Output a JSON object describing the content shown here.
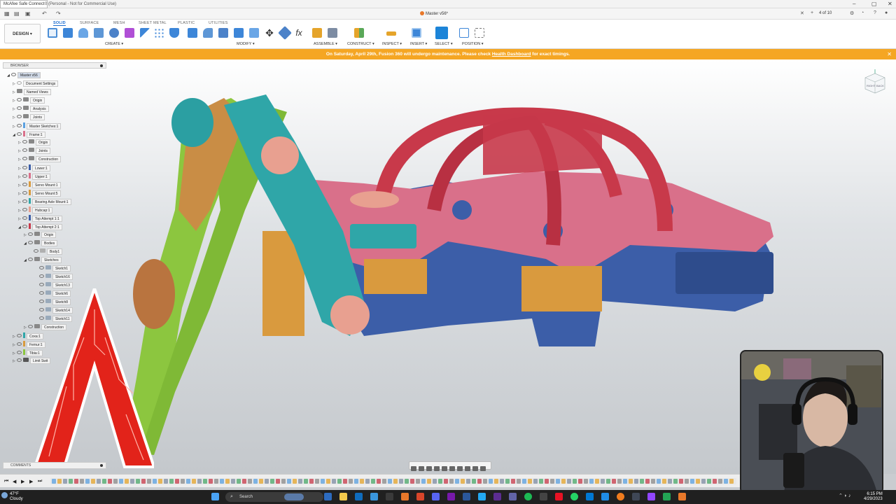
{
  "title_bar": {
    "notification": "McAfee Safe Connect",
    "subtitle": "0 (Personal - Not for Commercial Use)"
  },
  "document": {
    "title": "Master v56*",
    "page_indicator": "4 of 10"
  },
  "toolbar": {
    "workspace_button": "DESIGN ▾",
    "tabs": [
      "SOLID",
      "SURFACE",
      "MESH",
      "SHEET METAL",
      "PLASTIC",
      "UTILITIES"
    ],
    "active_tab": "SOLID",
    "groups": {
      "create": "CREATE ▾",
      "modify": "MODIFY ▾",
      "assemble": "ASSEMBLE ▾",
      "construct": "CONSTRUCT ▾",
      "inspect": "INSPECT ▾",
      "insert": "INSERT ▾",
      "select": "SELECT ▾",
      "position": "POSITION ▾"
    }
  },
  "banner": {
    "text_before": "On Saturday, April 29th, Fusion 360 will undergo maintenance. Please check ",
    "link": "Health Dashboard",
    "text_after": " for exact timings.",
    "close": "✕"
  },
  "browser": {
    "header": "BROWSER",
    "items": {
      "root": "Master v56",
      "document_settings": "Document Settings",
      "named_views": "Named Views",
      "origin": "Origin",
      "analysis": "Analysis",
      "joints": "Joints",
      "master_sketches": "Master Sketches:1",
      "frame": "Frame:1",
      "frame_origin": "Origin",
      "frame_joints": "Joints",
      "frame_construction": "Construction",
      "lower": "Lower:1",
      "upper": "Upper:1",
      "servo_mount_1": "Servo Mount:1",
      "servo_mount_5": "Servo Mount:5",
      "bearing_axle_mount": "Bearing Axle Mount:1",
      "hubcap": "Hubcap:1",
      "top_attempt_1": "Top Attempt 1:1",
      "top_attempt_2": "Top Attempt 2:1",
      "ta2_origin": "Origin",
      "ta2_bodies": "Bodies",
      "body1": "Body1",
      "ta2_sketches": "Sketches",
      "sketch1": "Sketch1",
      "sketch16": "Sketch16",
      "sketch13": "Sketch13",
      "sketch6": "Sketch6",
      "sketch8": "Sketch8",
      "sketch14": "Sketch14",
      "sketch11": "Sketch11",
      "ta2_construction": "Construction",
      "coxa": "Coxa:1",
      "femur": "Femur:1",
      "tibia": "Tibia:1",
      "limit_switch": "Limit Swit"
    }
  },
  "comments": {
    "label": "COMMENTS"
  },
  "viewcube": {
    "right": "RIGHT",
    "back": "BACK"
  },
  "taskbar": {
    "temperature": "47°F",
    "condition": "Cloudy",
    "search": "Search",
    "time": "6:15 PM",
    "date": "4/29/2023"
  },
  "colors": {
    "accent": "#1c6dd0",
    "banner": "#f5a623",
    "part_teal": "#2fa6a8",
    "part_green": "#8cc63f",
    "part_red": "#c8394a",
    "part_pink": "#d9708a",
    "part_blue": "#3c5ea8",
    "part_orange": "#d99a3e",
    "part_salmon": "#e8a090"
  }
}
